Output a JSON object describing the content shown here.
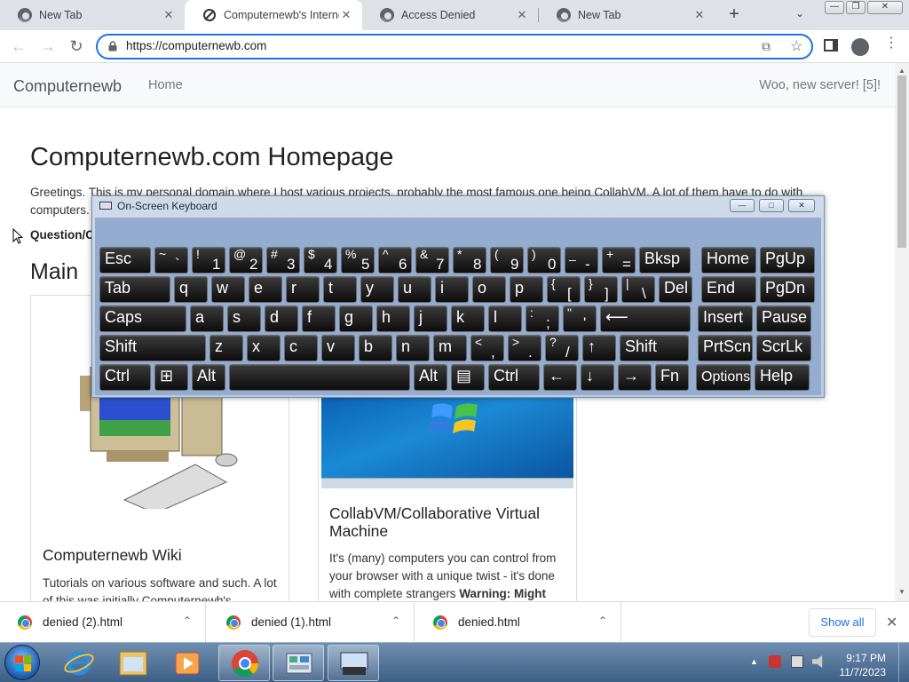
{
  "browser": {
    "tabs": [
      {
        "title": "New Tab",
        "active": false
      },
      {
        "title": "Computernewb's Internet",
        "active": true
      },
      {
        "title": "Access Denied",
        "active": false
      },
      {
        "title": "New Tab",
        "active": false
      }
    ],
    "new_tab": "+",
    "tab_close": "✕",
    "url": "https://computernewb.com"
  },
  "site": {
    "brand": "Computernewb",
    "nav_home": "Home",
    "nav_right": "Woo, new server! [5]!",
    "heading": "Computernewb.com Homepage",
    "greeting": "Greetings. This is my personal domain where I host various projects, probably the most famous one being CollabVM. A lot of them have to do with computers.",
    "question": "Question/C",
    "section": "Main",
    "card1_title": "Computernewb Wiki",
    "card1_text": "Tutorials on various software and such. A lot of this was initially Computernewb's",
    "card2_title": "CollabVM/Collaborative Virtual Machine",
    "card2_text_a": "It's (many) computers you can control from your browser with a unique twist - it's done with complete strangers ",
    "card2_text_b": "Warning: Might"
  },
  "osk": {
    "title": "On-Screen Keyboard",
    "rows": [
      [
        {
          "l": "Esc",
          "w": 60
        },
        {
          "s": "~",
          "p": "`",
          "w": 40
        },
        {
          "s": "!",
          "p": "1",
          "w": 40
        },
        {
          "s": "@",
          "p": "2",
          "w": 40
        },
        {
          "s": "#",
          "p": "3",
          "w": 40
        },
        {
          "s": "$",
          "p": "4",
          "w": 40
        },
        {
          "s": "%",
          "p": "5",
          "w": 40
        },
        {
          "s": "^",
          "p": "6",
          "w": 40
        },
        {
          "s": "&",
          "p": "7",
          "w": 40
        },
        {
          "s": "*",
          "p": "8",
          "w": 40
        },
        {
          "s": "(",
          "p": "9",
          "w": 40
        },
        {
          "s": ")",
          "p": "0",
          "w": 40
        },
        {
          "s": "_",
          "p": "-",
          "w": 40
        },
        {
          "s": "+",
          "p": "=",
          "w": 40
        },
        {
          "l": "Bksp",
          "w": 60
        },
        {
          "gap": 8
        },
        {
          "l": "Home",
          "w": 64
        },
        {
          "l": "PgUp",
          "w": 64
        }
      ],
      [
        {
          "l": "Tab",
          "w": 82
        },
        {
          "l": "q",
          "w": 40
        },
        {
          "l": "w",
          "w": 40
        },
        {
          "l": "e",
          "w": 40
        },
        {
          "l": "r",
          "w": 40
        },
        {
          "l": "t",
          "w": 40
        },
        {
          "l": "y",
          "w": 40
        },
        {
          "l": "u",
          "w": 40
        },
        {
          "l": "i",
          "w": 40
        },
        {
          "l": "o",
          "w": 40
        },
        {
          "l": "p",
          "w": 40
        },
        {
          "s": "{",
          "p": "[",
          "w": 40
        },
        {
          "s": "}",
          "p": "]",
          "w": 40
        },
        {
          "s": "|",
          "p": "\\",
          "w": 40
        },
        {
          "l": "Del",
          "w": 40
        },
        {
          "gap": 6
        },
        {
          "l": "End",
          "w": 64
        },
        {
          "l": "PgDn",
          "w": 64
        }
      ],
      [
        {
          "l": "Caps",
          "w": 100
        },
        {
          "l": "a",
          "w": 40
        },
        {
          "l": "s",
          "w": 40
        },
        {
          "l": "d",
          "w": 40
        },
        {
          "l": "f",
          "w": 40
        },
        {
          "l": "g",
          "w": 40
        },
        {
          "l": "h",
          "w": 40
        },
        {
          "l": "j",
          "w": 40
        },
        {
          "l": "k",
          "w": 40
        },
        {
          "l": "l",
          "w": 40
        },
        {
          "s": ":",
          "p": ";",
          "w": 40
        },
        {
          "s": "\"",
          "p": "'",
          "w": 40
        },
        {
          "l": "⟵",
          "w": 104
        },
        {
          "gap": 4
        },
        {
          "l": "Insert",
          "w": 64
        },
        {
          "l": "Pause",
          "w": 64
        }
      ],
      [
        {
          "l": "Shift",
          "w": 122
        },
        {
          "l": "z",
          "w": 40
        },
        {
          "l": "x",
          "w": 40
        },
        {
          "l": "c",
          "w": 40
        },
        {
          "l": "v",
          "w": 40
        },
        {
          "l": "b",
          "w": 40
        },
        {
          "l": "n",
          "w": 40
        },
        {
          "l": "m",
          "w": 40
        },
        {
          "s": "<",
          "p": ",",
          "w": 40
        },
        {
          "s": ">",
          "p": ".",
          "w": 40
        },
        {
          "s": "?",
          "p": "/",
          "w": 40
        },
        {
          "l": "↑",
          "w": 40
        },
        {
          "l": "Shift",
          "w": 80
        },
        {
          "gap": 6
        },
        {
          "l": "PrtScn",
          "w": 64
        },
        {
          "l": "ScrLk",
          "w": 64
        }
      ],
      [
        {
          "l": "Ctrl",
          "w": 60
        },
        {
          "l": "⊞",
          "w": 40
        },
        {
          "l": "Alt",
          "w": 40
        },
        {
          "l": "",
          "w": 206
        },
        {
          "l": "Alt",
          "w": 40
        },
        {
          "l": "▤",
          "w": 40
        },
        {
          "l": "Ctrl",
          "w": 60
        },
        {
          "l": "←",
          "w": 40
        },
        {
          "l": "↓",
          "w": 40
        },
        {
          "l": "→",
          "w": 40
        },
        {
          "l": "Fn",
          "w": 40
        },
        {
          "gap": 4
        },
        {
          "l": "Options",
          "w": 64,
          "small": true
        },
        {
          "l": "Help",
          "w": 64
        }
      ]
    ]
  },
  "downloads": {
    "items": [
      "denied (2).html",
      "denied (1).html",
      "denied.html"
    ],
    "show_all": "Show all"
  },
  "taskbar": {
    "time": "9:17 PM",
    "date": "11/7/2023"
  }
}
